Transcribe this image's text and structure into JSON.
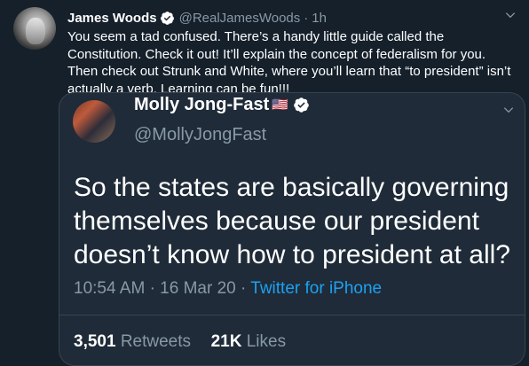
{
  "tweet": {
    "name": "James Woods",
    "handle": "@RealJamesWoods",
    "separator": "·",
    "time": "1h",
    "text": "You seem a tad confused. There’s a handy little guide called the Constitution. Check it out! It’ll explain the concept of federalism for you. Then check out Strunk and White, where you’ll learn that “to president” isn’t actually a verb. Learning can be fun!!!"
  },
  "quoted_tweet": {
    "name": "Molly Jong-Fast",
    "name_emoji": "🇺🇸",
    "handle": "@MollyJongFast",
    "text": "So the states are basically governing themselves because our president doesn’t know how to president at all?",
    "time": "10:54 AM",
    "separator": "·",
    "date": "16 Mar 20",
    "separator2": "·",
    "source": "Twitter for iPhone",
    "retweets_count": "3,501",
    "retweets_label": "Retweets",
    "likes_count": "21K",
    "likes_label": "Likes"
  },
  "icons": {
    "verified": "verified-badge-icon",
    "chevron": "chevron-down-icon"
  },
  "colors": {
    "background": "#15202b",
    "card_background": "#1f2b38",
    "secondary_text": "#8899a6",
    "accent": "#1da1f2",
    "border": "#38444d"
  }
}
